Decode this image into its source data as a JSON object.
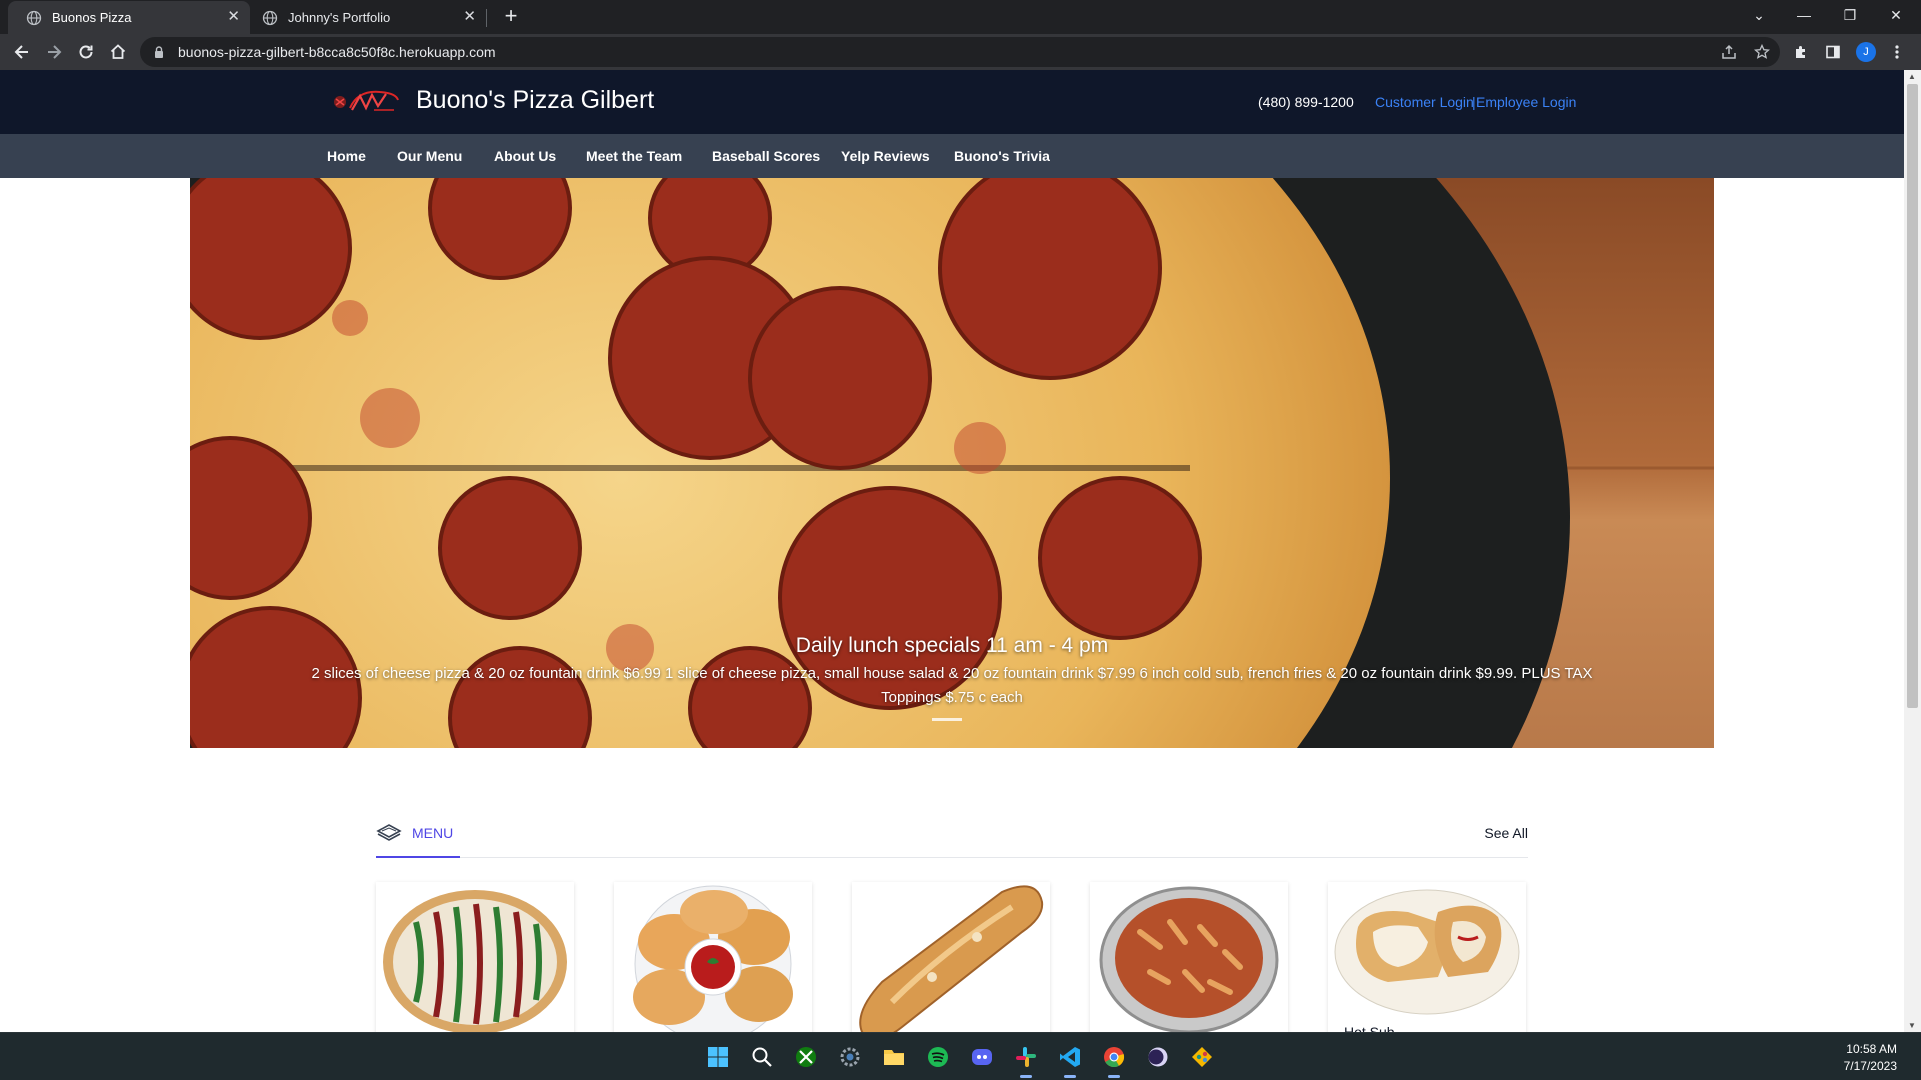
{
  "browser": {
    "tabs": [
      {
        "title": "Buonos Pizza",
        "active": true
      },
      {
        "title": "Johnny's Portfolio",
        "active": false
      }
    ],
    "url": "buonos-pizza-gilbert-b8cca8c50f8c.herokuapp.com",
    "profile_initial": "J"
  },
  "site": {
    "title": "Buono's Pizza Gilbert",
    "phone": "(480) 899-1200",
    "customer_login": "Customer Login",
    "separator": "|",
    "employee_login": "Employee Login",
    "nav": [
      "Home",
      "Our Menu",
      "About Us",
      "Meet the Team",
      "Baseball Scores",
      "Yelp Reviews",
      "Buono's Trivia"
    ]
  },
  "hero": {
    "heading": "Daily lunch specials 11 am - 4 pm",
    "body": "2 slices of cheese pizza & 20 oz fountain drink $6.99 1 slice of cheese pizza, small house salad & 20 oz fountain drink $7.99 6 inch cold sub, french fries & 20 oz fountain drink $9.99. PLUS TAX Toppings $.75 c each"
  },
  "menu": {
    "tab_label": "MENU",
    "see_all": "See All",
    "items": [
      {
        "title": "",
        "image": "pizza-photo"
      },
      {
        "title": "",
        "image": "calzone-plate-photo"
      },
      {
        "title": "",
        "image": "breadstick-photo"
      },
      {
        "title": "",
        "image": "pasta-tray-photo"
      },
      {
        "title": "Hot Sub",
        "image": "hot-sub-plate-photo"
      }
    ]
  },
  "taskbar": {
    "apps": [
      "windows-start-icon",
      "search-icon",
      "xbox-icon",
      "settings-icon",
      "file-explorer-icon",
      "spotify-icon",
      "discord-icon",
      "slack-icon",
      "vscode-icon",
      "chrome-icon",
      "eclipse-icon",
      "gitkraken-icon"
    ],
    "time": "10:58 AM",
    "date": "7/17/2023"
  },
  "colors": {
    "header_bg": "#0f172a",
    "nav_bg": "#374151",
    "link_blue": "#3b82f6",
    "menu_accent": "#4f46e5"
  }
}
